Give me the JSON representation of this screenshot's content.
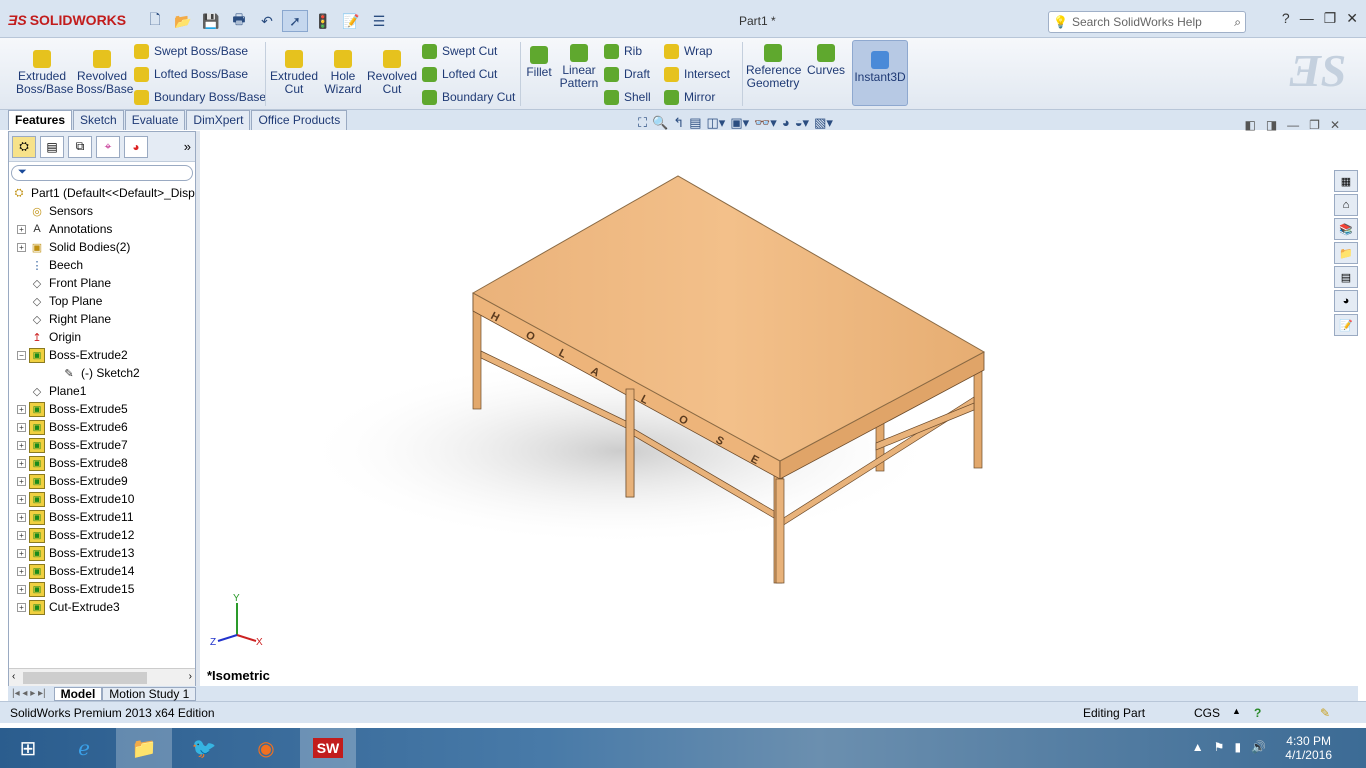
{
  "app": {
    "brand": "SOLIDWORKS",
    "window_title": "Part1 *"
  },
  "search": {
    "placeholder": "Search SolidWorks Help"
  },
  "ribbon": {
    "extruded_boss": "Extruded Boss/Base",
    "revolved_boss": "Revolved Boss/Base",
    "swept_boss": "Swept Boss/Base",
    "lofted_boss": "Lofted Boss/Base",
    "boundary_boss": "Boundary Boss/Base",
    "extruded_cut": "Extruded Cut",
    "hole_wizard": "Hole Wizard",
    "revolved_cut": "Revolved Cut",
    "swept_cut": "Swept Cut",
    "lofted_cut": "Lofted Cut",
    "boundary_cut": "Boundary Cut",
    "fillet": "Fillet",
    "linear_pattern": "Linear Pattern",
    "rib": "Rib",
    "draft": "Draft",
    "shell": "Shell",
    "wrap": "Wrap",
    "intersect": "Intersect",
    "mirror": "Mirror",
    "reference_geometry": "Reference Geometry",
    "curves": "Curves",
    "instant3d": "Instant3D"
  },
  "tabs": [
    "Features",
    "Sketch",
    "Evaluate",
    "DimXpert",
    "Office Products"
  ],
  "tree": {
    "root": "Part1  (Default<<Default>_Disp",
    "items": [
      {
        "label": "Sensors",
        "expand": false
      },
      {
        "label": "Annotations",
        "expand": true
      },
      {
        "label": "Solid Bodies(2)",
        "expand": true
      },
      {
        "label": "Beech",
        "expand": false
      },
      {
        "label": "Front Plane",
        "expand": false
      },
      {
        "label": "Top Plane",
        "expand": false
      },
      {
        "label": "Right Plane",
        "expand": false
      },
      {
        "label": "Origin",
        "expand": false
      },
      {
        "label": "Boss-Extrude2",
        "expand": true
      },
      {
        "label": "(-) Sketch2",
        "expand": false
      },
      {
        "label": "Plane1",
        "expand": false
      },
      {
        "label": "Boss-Extrude5",
        "expand": true
      },
      {
        "label": "Boss-Extrude6",
        "expand": true
      },
      {
        "label": "Boss-Extrude7",
        "expand": true
      },
      {
        "label": "Boss-Extrude8",
        "expand": true
      },
      {
        "label": "Boss-Extrude9",
        "expand": true
      },
      {
        "label": "Boss-Extrude10",
        "expand": true
      },
      {
        "label": "Boss-Extrude11",
        "expand": true
      },
      {
        "label": "Boss-Extrude12",
        "expand": true
      },
      {
        "label": "Boss-Extrude13",
        "expand": true
      },
      {
        "label": "Boss-Extrude14",
        "expand": true
      },
      {
        "label": "Boss-Extrude15",
        "expand": true
      },
      {
        "label": "Cut-Extrude3",
        "expand": true
      }
    ]
  },
  "viewport": {
    "view_label": "*Isometric",
    "axis_x": "X",
    "axis_y": "Y",
    "axis_z": "Z"
  },
  "bottom_tabs": [
    "Model",
    "Motion Study 1"
  ],
  "status": {
    "edition": "SolidWorks Premium 2013 x64 Edition",
    "mode": "Editing Part",
    "units": "CGS"
  },
  "taskbar": {
    "time": "4:30 PM",
    "date": "4/1/2016"
  },
  "colors": {
    "wood_top": "#e8b074",
    "wood_leg": "#e8b27a",
    "accent": "#1f3a75"
  }
}
